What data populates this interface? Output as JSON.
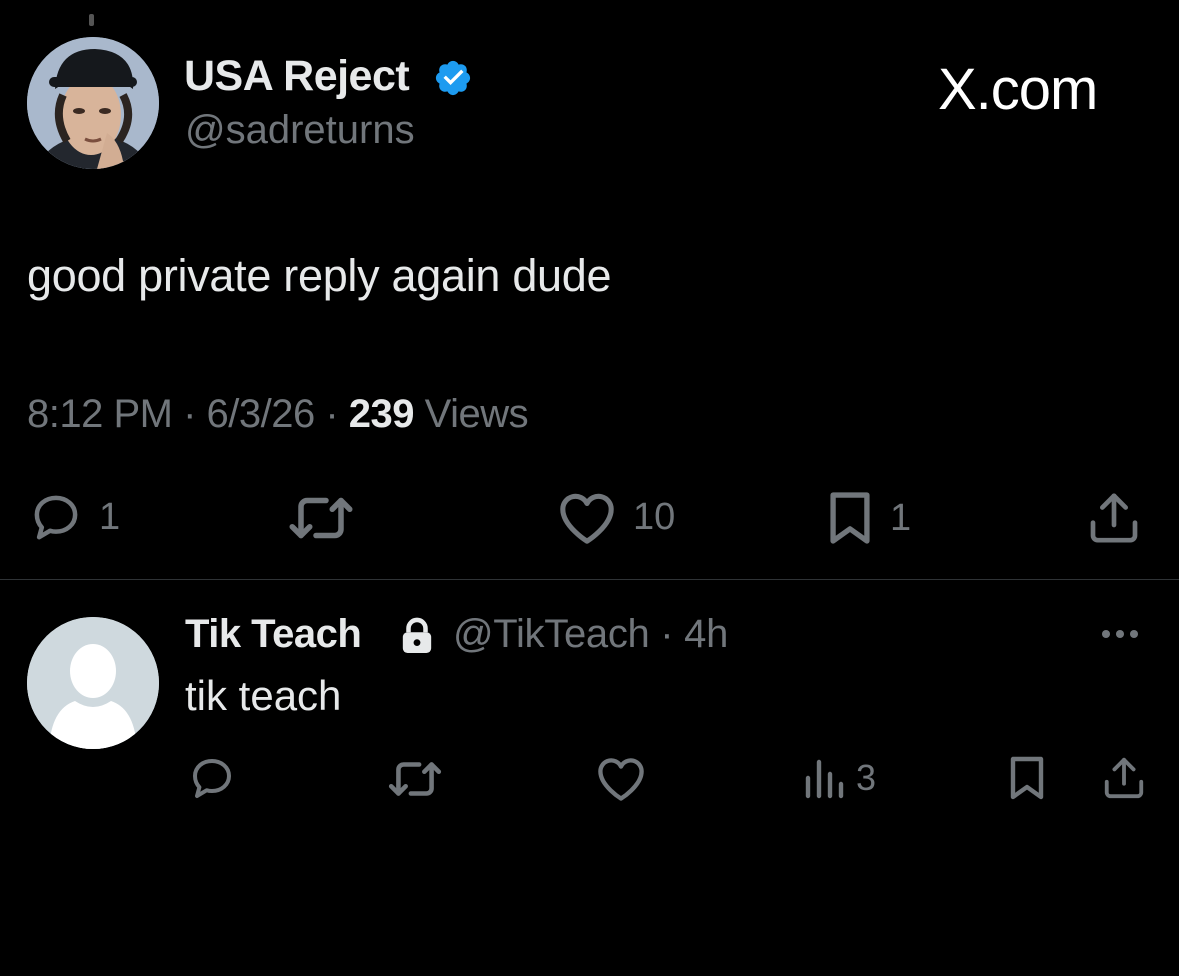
{
  "tweet": {
    "author": {
      "display_name": "USA Reject",
      "handle": "@sadreturns",
      "verified": true
    },
    "brand": "X.com",
    "text": "good private reply again dude",
    "time": "8:12 PM",
    "date": "6/3/26",
    "views_count": "239",
    "views_label": "Views",
    "separator": " · ",
    "actions": {
      "reply_count": "1",
      "retweet_count": "",
      "like_count": "10",
      "bookmark_count": "1"
    }
  },
  "reply": {
    "author": {
      "display_name": "Tik Teach",
      "handle": "@TikTeach",
      "protected": true
    },
    "age": "4h",
    "text": "tik teach",
    "actions": {
      "views_count": "3"
    }
  },
  "colors": {
    "background": "#000000",
    "text_primary": "#e7e9ea",
    "text_secondary": "#71767b",
    "verified_blue": "#1d9bf0",
    "divider": "#2f3336"
  }
}
